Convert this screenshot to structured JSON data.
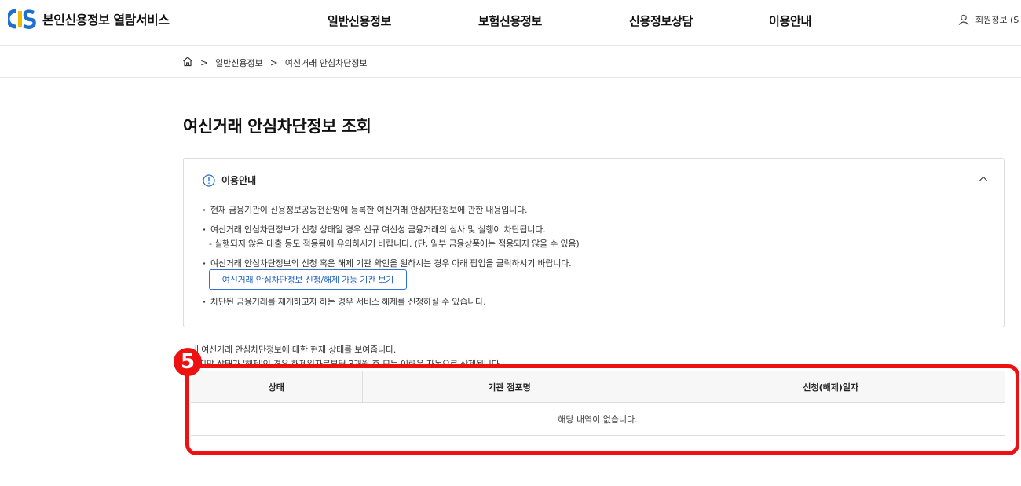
{
  "header": {
    "logo_text": "본인신용정보 열람서비스",
    "nav": [
      "일반신용정보",
      "보험신용정보",
      "신용정보상담",
      "이용안내"
    ],
    "member_label": "회원정보 (S"
  },
  "breadcrumb": {
    "items": [
      "일반신용정보",
      "여신거래 안심차단정보"
    ]
  },
  "page": {
    "title": "여신거래 안심차단정보 조회"
  },
  "info_panel": {
    "heading": "이용안내",
    "bullets": [
      "현재 금융기관이 신용정보공동전산망에 등록한 여신거래 안심차단정보에 관한 내용입니다.",
      "여신거래 안심차단정보가 신청 상태일 경우 신규 여신성 금융거래의 심사 및 실행이 차단됩니다.",
      "여신거래 안심차단정보의 신청 혹은 해제 기관 확인을 원하시는 경우 아래 팝업을 클릭하시기 바랍니다.",
      "차단된 금융거래를 재개하고자 하는 경우 서비스 해제를 신청하실 수 있습니다."
    ],
    "sub_note": "- 실행되지 않은 대출 등도 적용됨에 유의하시기 바랍니다. (단, 일부 금융상품에는 적용되지 않을 수 있음)",
    "popup_button": "여신거래 안심차단정보 신청/해제 가능 기관 보기"
  },
  "status_notes": [
    "내 여신거래 안심차단정보에 대한 현재 상태를 보여줍니다.",
    "마지막 상태가 '해제'인 경우 해제일자로부터 3개월 후 모든 이력은 자동으로 삭제됩니다."
  ],
  "table": {
    "columns": [
      "상태",
      "기관 점포명",
      "신청(해제)일자"
    ],
    "empty_message": "해당 내역이 없습니다."
  },
  "annotation": {
    "step": "5",
    "color": "#ee1111"
  },
  "colors": {
    "accent_blue": "#2f6fd6",
    "logo_blue": "#1f6fd0",
    "logo_yellow": "#f5b800"
  }
}
